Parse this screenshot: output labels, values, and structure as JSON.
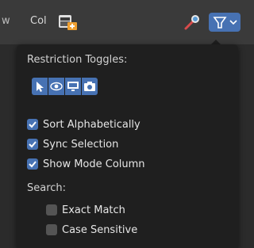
{
  "header": {
    "partial_label_left": "w",
    "col_label": "Col"
  },
  "popover": {
    "restriction_title": "Restriction Toggles:",
    "restriction_toggles": [
      {
        "icon": "select-arrow-icon",
        "enabled": true
      },
      {
        "icon": "eye-icon",
        "enabled": true
      },
      {
        "icon": "monitor-icon",
        "enabled": true
      },
      {
        "icon": "camera-icon",
        "enabled": true
      }
    ],
    "options": [
      {
        "label": "Sort Alphabetically",
        "checked": true
      },
      {
        "label": "Sync Selection",
        "checked": true
      },
      {
        "label": "Show Mode Column",
        "checked": true
      }
    ],
    "search_title": "Search:",
    "search_options": [
      {
        "label": "Exact Match",
        "checked": false
      },
      {
        "label": "Case Sensitive",
        "checked": false
      }
    ]
  },
  "colors": {
    "accent": "#4772b3",
    "popover_bg": "#1f1f1f",
    "header_bg": "#3a3a3a"
  }
}
